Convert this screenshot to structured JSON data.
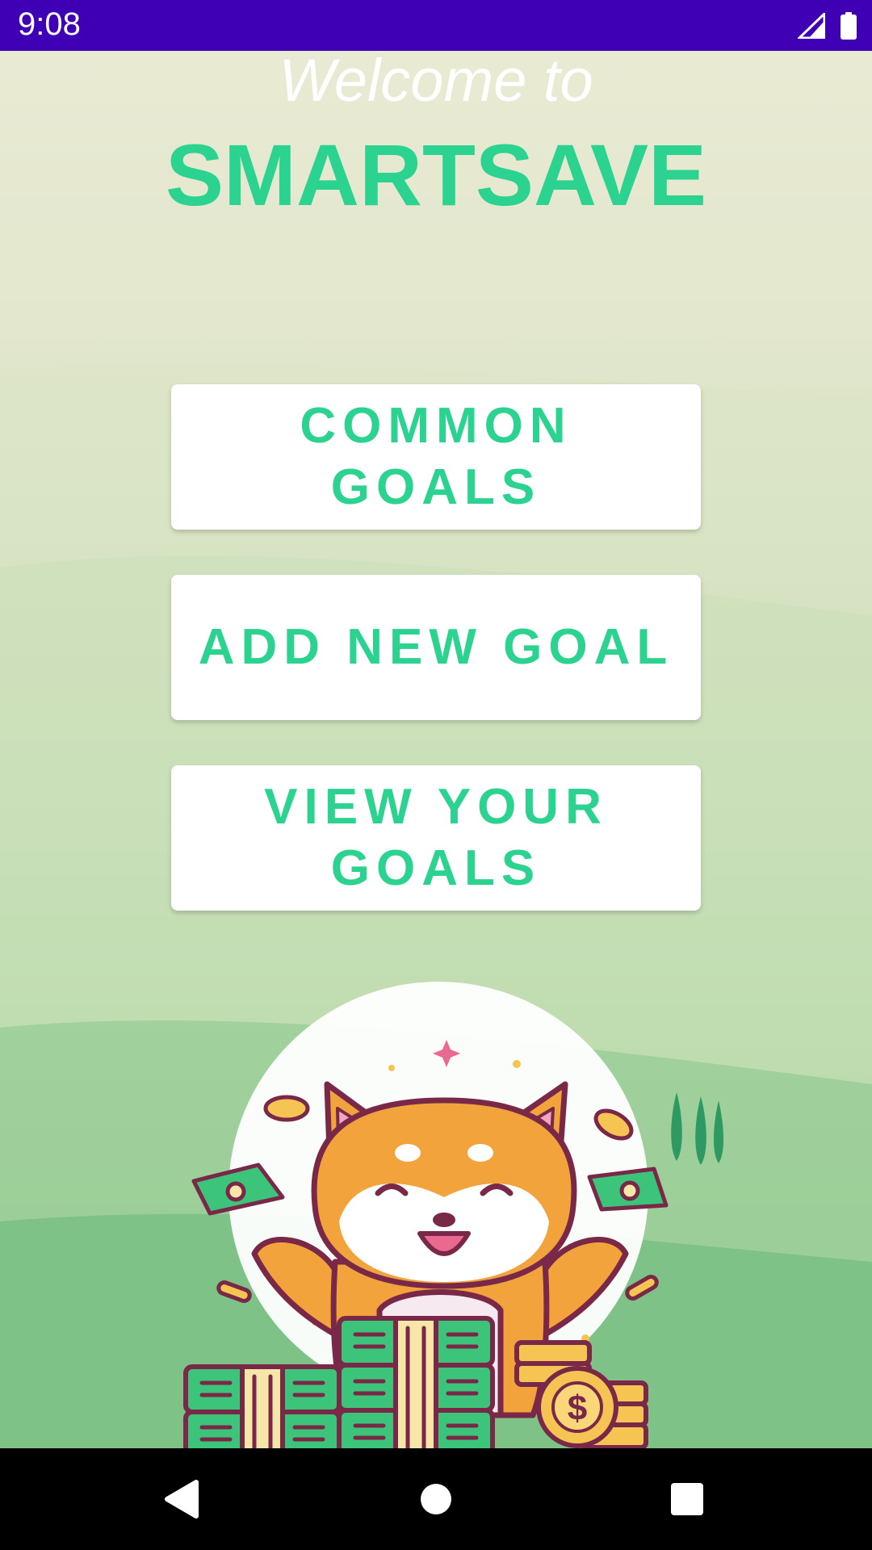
{
  "status_bar": {
    "time": "9:08",
    "icons": [
      "signal-icon",
      "battery-icon"
    ],
    "background": "#3F00B5"
  },
  "header": {
    "welcome": "Welcome to",
    "app_name": "SMARTSAVE"
  },
  "buttons": {
    "common_goals": "COMMON GOALS",
    "add_new_goal": "ADD NEW GOAL",
    "view_your_goals": "VIEW YOUR GOALS"
  },
  "colors": {
    "accent": "#2CD390",
    "button_bg": "#FFFFFF"
  },
  "illustration": {
    "subject": "shiba-dog-with-money-icon"
  },
  "nav_bar": {
    "icons": [
      "back-icon",
      "home-icon",
      "recents-icon"
    ]
  }
}
